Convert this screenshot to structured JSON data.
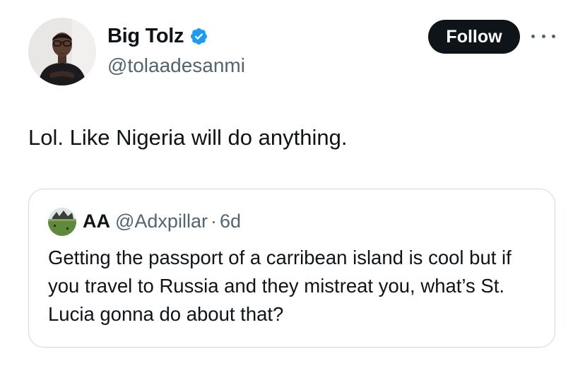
{
  "author": {
    "display_name": "Big Tolz",
    "handle": "@tolaadesanmi",
    "verified": true,
    "avatar_icon": "person-avatar"
  },
  "actions": {
    "follow_label": "Follow",
    "more_icon": "more-horizontal-icon"
  },
  "tweet": {
    "text": "Lol. Like Nigeria will do anything."
  },
  "quoted_tweet": {
    "display_name": "AA",
    "handle": "@Adxpillar",
    "separator": "·",
    "time": "6d",
    "avatar_icon": "field-avatar",
    "text": "Getting the passport of a carribean island is cool but if you travel to Russia and they mistreat you, what’s St. Lucia gonna do about that?"
  },
  "colors": {
    "text_primary": "#0f1419",
    "text_secondary": "#536471",
    "verified_badge": "#1d9bf0",
    "follow_button_bg": "#0f1419",
    "card_border": "#cfd9de"
  }
}
